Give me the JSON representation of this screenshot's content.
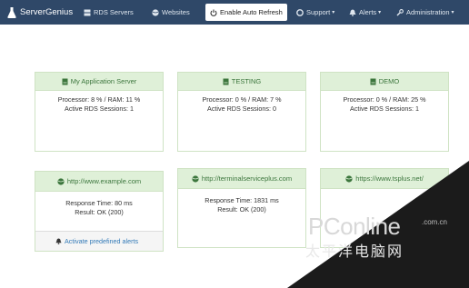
{
  "navbar": {
    "brand": "ServerGenius",
    "items": [
      {
        "label": "RDS Servers"
      },
      {
        "label": "Websites"
      },
      {
        "label": "Enable Auto Refresh"
      },
      {
        "label": "Support"
      },
      {
        "label": "Alerts"
      },
      {
        "label": "Administration"
      }
    ]
  },
  "servers": [
    {
      "name": "My Application Server",
      "stats": "Processor: 8 % / RAM: 11 %",
      "sessions": "Active RDS Sessions: 1"
    },
    {
      "name": "TESTING",
      "stats": "Processor: 0 % / RAM: 7 %",
      "sessions": "Active RDS Sessions: 0"
    },
    {
      "name": "DEMO",
      "stats": "Processor: 0 % / RAM: 25 %",
      "sessions": "Active RDS Sessions: 1"
    }
  ],
  "websites": [
    {
      "url": "http://www.example.com",
      "response": "Response Time: 80 ms",
      "result": "Result: OK (200)",
      "footer": "Activate predefined alerts"
    },
    {
      "url": "http://terminalserviceplus.com",
      "response": "Response Time: 1831 ms",
      "result": "Result: OK (200)"
    },
    {
      "url": "https://www.tsplus.net/"
    }
  ],
  "watermark": {
    "logo": "PConline",
    "suffix": ".com.cn",
    "chinese": "太平洋电脑网"
  },
  "colors": {
    "navbar": "#2f4868",
    "panel_heading": "#dff0d8",
    "panel_heading_text": "#3c763d",
    "link": "#337ab7"
  }
}
